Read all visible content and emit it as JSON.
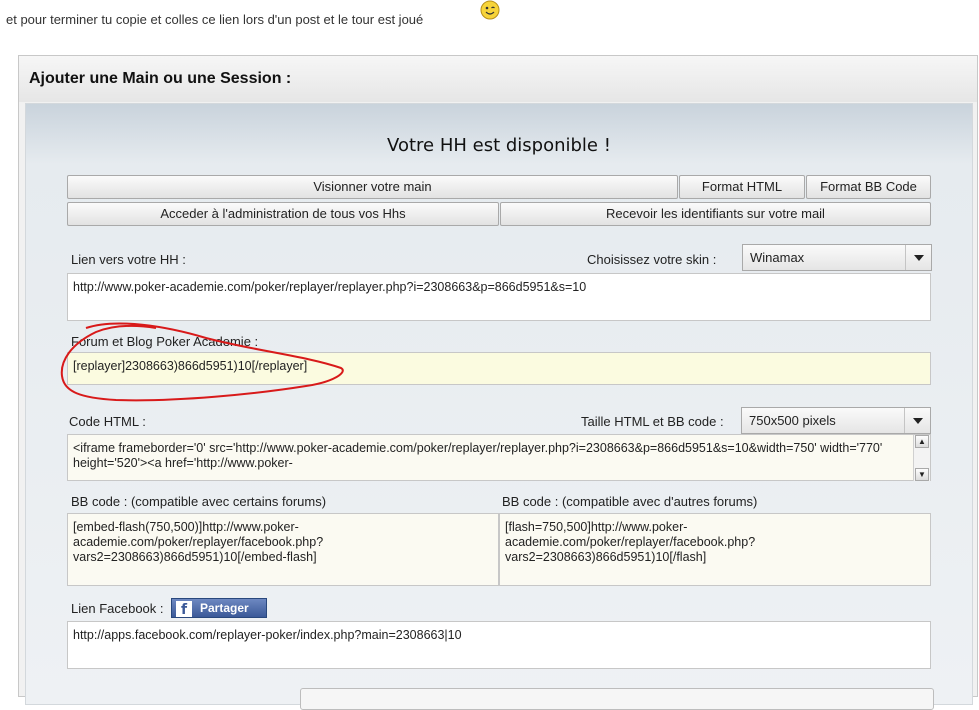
{
  "intro_text": "et pour terminer tu copie et colles ce lien lors d'un post et le tour est joué",
  "panel": {
    "title": "Ajouter une Main ou une Session :",
    "headline": "Votre HH est disponible !"
  },
  "buttons": {
    "view_hand": "Visionner votre main",
    "format_html": "Format HTML",
    "format_bb": "Format BB Code",
    "admin": "Acceder à l'administration de tous vos Hhs",
    "receive_ids": "Recevoir les identifiants sur votre mail"
  },
  "hh_link": {
    "label": "Lien vers votre HH :",
    "value": "http://www.poker-academie.com/poker/replayer/replayer.php?i=2308663&p=866d5951&s=10"
  },
  "skin": {
    "label": "Choisissez votre skin :",
    "selected": "Winamax"
  },
  "forum": {
    "label": "Forum et Blog Poker Academie :",
    "value": "[replayer]2308663)866d5951)10[/replayer]"
  },
  "html_code": {
    "label": "Code HTML :",
    "value": "<iframe frameborder='0' src='http://www.poker-academie.com/poker/replayer/replayer.php?i=2308663&p=866d5951&s=10&width=750' width='770' height='520'><a href='http://www.poker-"
  },
  "size": {
    "label": "Taille HTML et BB code :",
    "selected": "750x500 pixels"
  },
  "bb_certain": {
    "label": "BB code : (compatible avec certains forums)",
    "value": "[embed-flash(750,500)]http://www.poker-academie.com/poker/replayer/facebook.php?vars2=2308663)866d5951)10[/embed-flash]"
  },
  "bb_other": {
    "label": "BB code : (compatible avec d'autres forums)",
    "value": "[flash=750,500]http://www.poker-academie.com/poker/replayer/facebook.php?vars2=2308663)866d5951)10[/flash]"
  },
  "facebook": {
    "label": "Lien Facebook :",
    "share_button": "Partager",
    "value": "http://apps.facebook.com/replayer-poker/index.php?main=2308663|10"
  },
  "colors": {
    "highlight": "#fbfbe0",
    "annotation": "#d81a1a",
    "facebook_blue": "#3b5998"
  }
}
